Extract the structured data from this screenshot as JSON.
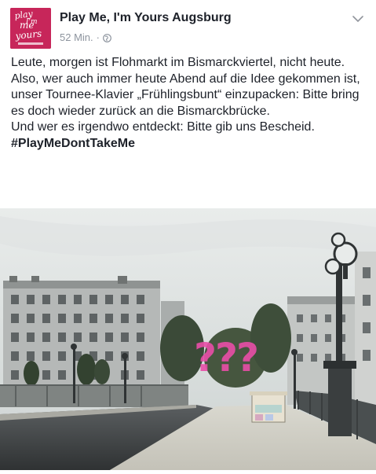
{
  "post": {
    "page_name": "Play Me, I'm Yours Augsburg",
    "timestamp": "52 Min.",
    "separator": "·",
    "privacy_icon": "globe-icon",
    "menu_icon": "chevron-down-icon",
    "avatar_logo_text": [
      "play",
      "me",
      "I'm",
      "yours"
    ]
  },
  "body": {
    "paragraph1": "Leute, morgen ist Flohmarkt im Bismarckviertel, nicht heute. Also, wer auch immer heute Abend auf die Idee gekommen ist, unser Tournee-Klavier „Frühlingsbunt“ einzupacken: Bitte bring es doch wieder zurück an die Bismarckbrücke.",
    "paragraph2": "Und wer es irgendwo entdeckt: Bitte gib uns Bescheid.",
    "hashtag": "#PlayMeDontTakeMe"
  },
  "photo": {
    "overlay_text": "???",
    "overlay_color": "#e94ea8"
  },
  "colors": {
    "brand": "#c7265a",
    "text": "#1d2129",
    "meta": "#8d949e"
  }
}
